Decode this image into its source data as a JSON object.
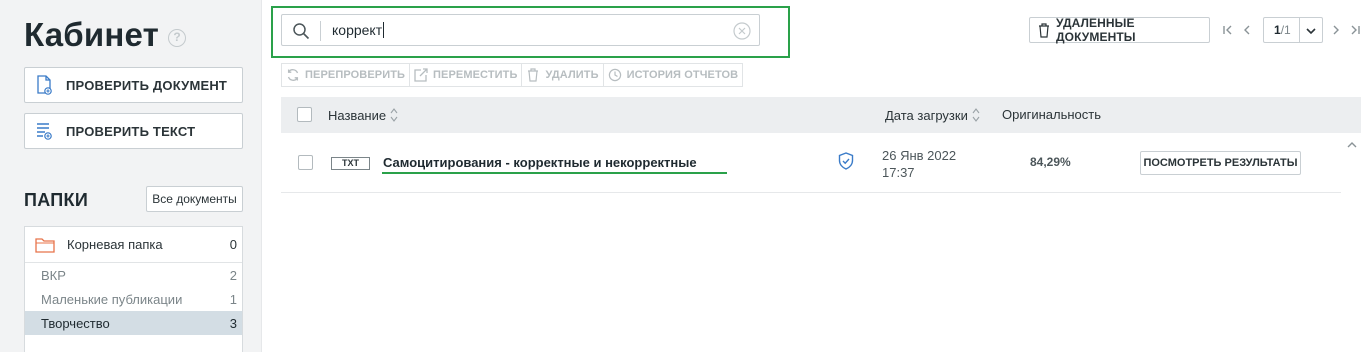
{
  "sidebar": {
    "title": "Кабинет",
    "help": "?",
    "check_document": "ПРОВЕРИТЬ ДОКУМЕНТ",
    "check_text": "ПРОВЕРИТЬ ТЕКСТ",
    "folders_title": "ПАПКИ",
    "all_documents": "Все документы",
    "root_folder": {
      "label": "Корневая папка",
      "count": "0"
    },
    "subfolders": [
      {
        "label": "ВКР",
        "count": "2"
      },
      {
        "label": "Маленькие публикации",
        "count": "1"
      },
      {
        "label": "Творчество",
        "count": "3",
        "active": true
      }
    ]
  },
  "search": {
    "value": "коррект"
  },
  "toolbar": {
    "deleted_documents": "УДАЛЕННЫЕ ДОКУМЕНТЫ",
    "page_current": "1",
    "page_total": "/1"
  },
  "actions": {
    "recheck": "ПЕРЕПРОВЕРИТЬ",
    "move": "ПЕРЕМЕСТИТЬ",
    "delete": "УДАЛИТЬ",
    "history": "ИСТОРИЯ ОТЧЕТОВ"
  },
  "table": {
    "columns": {
      "name": "Название",
      "date": "Дата загрузки",
      "originality": "Оригинальность"
    },
    "rows": [
      {
        "type": "TXT",
        "title": "Самоцитирования - корректные и некорректные",
        "date": "26 Янв 2022",
        "time": "17:37",
        "originality": "84,29%",
        "view_results": "ПОСМОТРЕТЬ РЕЗУЛЬТАТЫ"
      }
    ]
  },
  "colors": {
    "accent_green": "#2aa14a",
    "folder_orange": "#e8734a",
    "shield_blue": "#3a7bc8",
    "active_folder_bg": "#d3dde4"
  }
}
